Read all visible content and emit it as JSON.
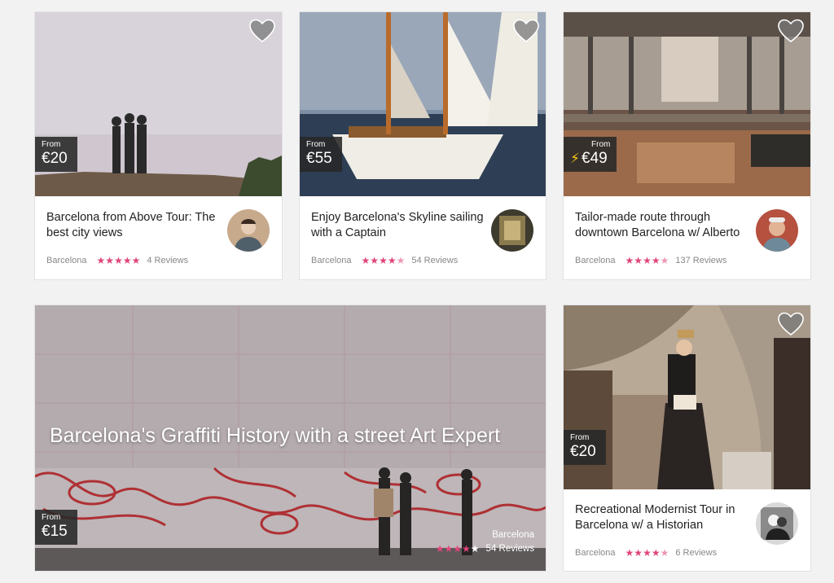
{
  "cards": [
    {
      "title": "Barcelona from Above Tour: The best city views",
      "price_from": "From",
      "price": "€20",
      "city": "Barcelona",
      "rating_stars": "★★★★★",
      "reviews": "4 Reviews"
    },
    {
      "title": "Enjoy Barcelona's Skyline sailing with a Captain",
      "price_from": "From",
      "price": "€55",
      "city": "Barcelona",
      "rating_stars": "★★★★",
      "rating_half": "★",
      "reviews": "54 Reviews"
    },
    {
      "title": "Tailor-made route through downtown Barcelona w/ Alberto",
      "price_from": "From",
      "price": "€49",
      "instant_icon": "lightning-icon",
      "city": "Barcelona",
      "rating_stars": "★★★★",
      "rating_half": "★",
      "reviews": "137 Reviews"
    },
    {
      "title": "Barcelona's Graffiti History with a street Art Expert",
      "price_from": "From",
      "price": "€15",
      "city": "Barcelona",
      "rating_stars": "★★★★",
      "rating_half": "★",
      "reviews": "54 Reviews"
    },
    {
      "title": "Recreational Modernist Tour in Barcelona w/ a Historian",
      "price_from": "From",
      "price": "€20",
      "city": "Barcelona",
      "rating_stars": "★★★★",
      "rating_half": "★",
      "reviews": "6 Reviews"
    }
  ],
  "colors": {
    "star": "#e0457b",
    "price_bg": "#282828",
    "bolt": "#f5c518"
  },
  "icons": {
    "favorite": "heart-icon",
    "instant": "lightning-icon"
  }
}
